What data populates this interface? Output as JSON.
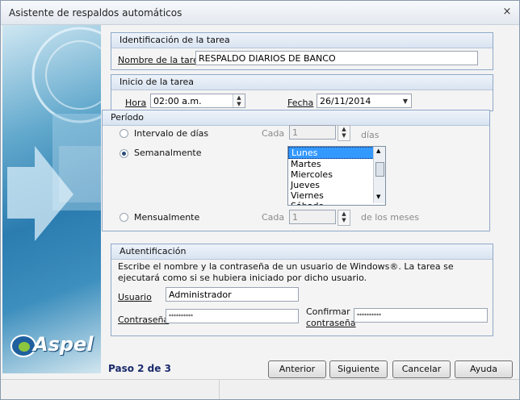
{
  "window": {
    "title": "Asistente de respaldos automáticos",
    "close_glyph": "×"
  },
  "brand": {
    "logo_text": "Aspel"
  },
  "task_id": {
    "header": "Identificación de la tarea",
    "name_label": "Nombre de la tarea",
    "name_value": "RESPALDO DIARIOS DE BANCO"
  },
  "start": {
    "header": "Inicio de la tarea",
    "hora_label": "Hora",
    "hora_value": "02:00 a.m.",
    "fecha_label": "Fecha",
    "fecha_value": "26/11/2014"
  },
  "period": {
    "header": "Período",
    "interval_label": "Intervalo de días",
    "weekly_label": "Semanalmente",
    "monthly_label": "Mensualmente",
    "cada_label": "Cada",
    "days_value": "1",
    "days_unit": "días",
    "months_value": "1",
    "months_unit": "de los meses",
    "selected": "weekly",
    "days": [
      "Lunes",
      "Martes",
      "Miercoles",
      "Jueves",
      "Viernes",
      "Sábado"
    ]
  },
  "auth": {
    "header": "Autentificación",
    "description": "Escribe el nombre y la contraseña de un usuario de Windows®. La tarea se ejecutará como si se hubiera iniciado por dicho usuario.",
    "user_label": "Usuario",
    "user_value": "Administrador",
    "password_label": "Contraseña",
    "password_value": "**********",
    "confirm_label_1": "Confirmar",
    "confirm_label_2": "contraseña",
    "confirm_value": "**********"
  },
  "footer": {
    "step": "Paso 2 de 3",
    "back": "Anterior",
    "next": "Siguiente",
    "cancel": "Cancelar",
    "help": "Ayuda"
  }
}
